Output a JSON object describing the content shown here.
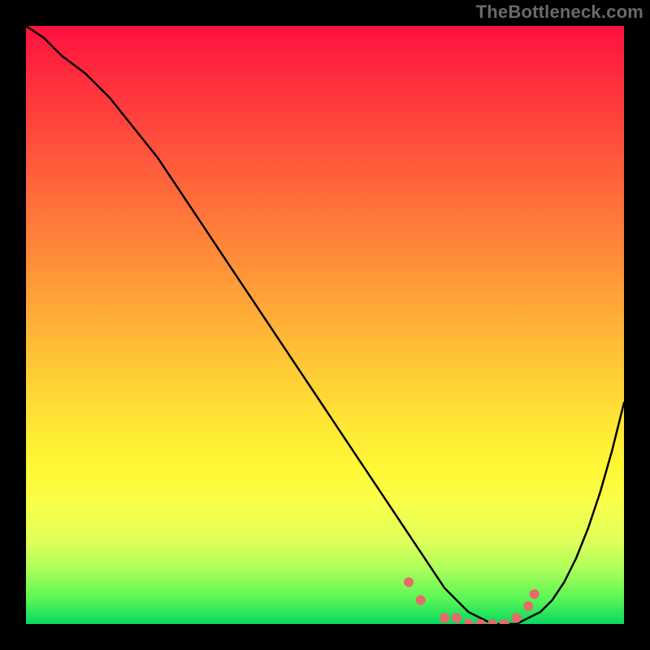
{
  "watermark": "TheBottleneck.com",
  "colors": {
    "background": "#000000",
    "curve": "#000000",
    "marker": "#e86a6a",
    "gradient_stops": [
      "#ff1040",
      "#ff2b3d",
      "#ff4a3c",
      "#ff6a3b",
      "#ff8a39",
      "#ffab37",
      "#ffcc36",
      "#ffe536",
      "#fff835",
      "#f8ff4a",
      "#e0ff5a",
      "#aaff5a",
      "#55f555",
      "#08d860"
    ]
  },
  "chart_data": {
    "type": "line",
    "title": "",
    "xlabel": "",
    "ylabel": "",
    "xlim": [
      0,
      100
    ],
    "ylim": [
      0,
      100
    ],
    "series": [
      {
        "name": "curve",
        "x": [
          0,
          3,
          6,
          10,
          14,
          18,
          22,
          26,
          30,
          34,
          38,
          42,
          46,
          50,
          54,
          58,
          62,
          64,
          66,
          68,
          70,
          72,
          74,
          76,
          78,
          80,
          82,
          84,
          86,
          88,
          90,
          92,
          94,
          96,
          98,
          100
        ],
        "y": [
          100,
          98,
          95,
          92,
          88,
          83,
          78,
          72,
          66,
          60,
          54,
          48,
          42,
          36,
          30,
          24,
          18,
          15,
          12,
          9,
          6,
          4,
          2,
          1,
          0,
          0,
          0,
          1,
          2,
          4,
          7,
          11,
          16,
          22,
          29,
          37
        ]
      }
    ],
    "markers": {
      "name": "highlight",
      "x": [
        64,
        66,
        70,
        72,
        74,
        76,
        78,
        80,
        82,
        84,
        85
      ],
      "y": [
        7,
        4,
        1,
        1,
        0,
        0,
        0,
        0,
        1,
        3,
        5
      ]
    },
    "axes_visible": false,
    "grid": false,
    "legend": false
  }
}
